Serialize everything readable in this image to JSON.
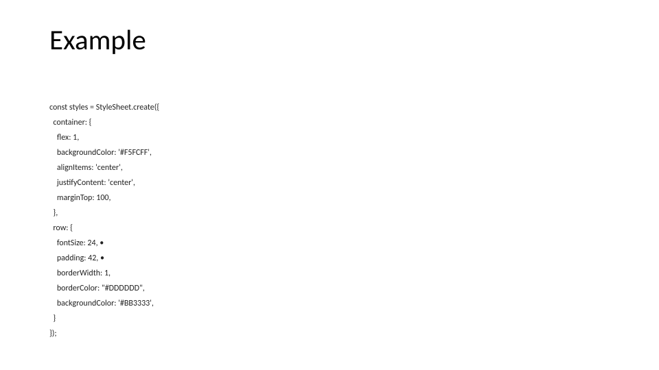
{
  "title": "Example",
  "code": {
    "l01": "const styles = StyleSheet.create({",
    "l02": "  container: {",
    "l03": "    flex: 1,",
    "l04": "    backgroundColor: '#F5FCFF',",
    "l05": "    alignItems: 'center',",
    "l06": "    justifyContent: 'center',",
    "l07": "    marginTop: 100,",
    "l08": "  },",
    "l09": "  row: {",
    "l10": "    fontSize: 24, •",
    "l11": "    padding: 42, •",
    "l12": "    borderWidth: 1,",
    "l13": "    borderColor: \"#DDDDDD\",",
    "l14": "    backgroundColor: '#BB3333',",
    "l15": "  }",
    "l16": "});"
  }
}
